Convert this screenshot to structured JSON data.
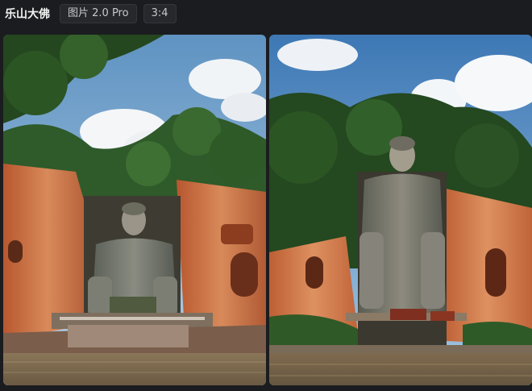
{
  "header": {
    "title": "乐山大佛",
    "model_tag": "图片 2.0 Pro",
    "ratio_tag": "3:4"
  },
  "images": [
    {
      "name": "leshan-buddha-image-1"
    },
    {
      "name": "leshan-buddha-image-2"
    }
  ],
  "colors": {
    "background": "#1b1c1f",
    "tag_bg": "#26282c",
    "cliff": "#c5663a",
    "foliage": "#2f5a2a",
    "sky": "#7fb2d8",
    "water": "#7b6a4e"
  }
}
